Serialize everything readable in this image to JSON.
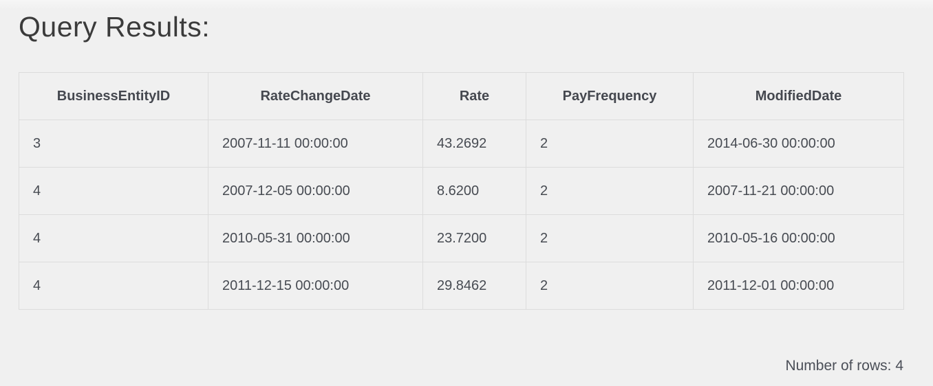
{
  "page": {
    "title": "Query Results:",
    "row_count_label": "Number of rows: 4"
  },
  "table": {
    "columns": [
      {
        "key": "businessentityid",
        "label": "BusinessEntityID"
      },
      {
        "key": "ratechangedate",
        "label": "RateChangeDate"
      },
      {
        "key": "rate",
        "label": "Rate"
      },
      {
        "key": "payfrequency",
        "label": "PayFrequency"
      },
      {
        "key": "modifieddate",
        "label": "ModifiedDate"
      }
    ],
    "rows": [
      [
        "3",
        "2007-11-11 00:00:00",
        "43.2692",
        "2",
        "2014-06-30 00:00:00"
      ],
      [
        "4",
        "2007-12-05 00:00:00",
        "8.6200",
        "2",
        "2007-11-21 00:00:00"
      ],
      [
        "4",
        "2010-05-31 00:00:00",
        "23.7200",
        "2",
        "2010-05-16 00:00:00"
      ],
      [
        "4",
        "2011-12-15 00:00:00",
        "29.8462",
        "2",
        "2011-12-01 00:00:00"
      ]
    ],
    "row_count": 4
  },
  "colors": {
    "page_background": "#f0f0f0",
    "table_border": "#dcdcdc",
    "text": "#474b52",
    "title_text": "#3b3b3b"
  }
}
